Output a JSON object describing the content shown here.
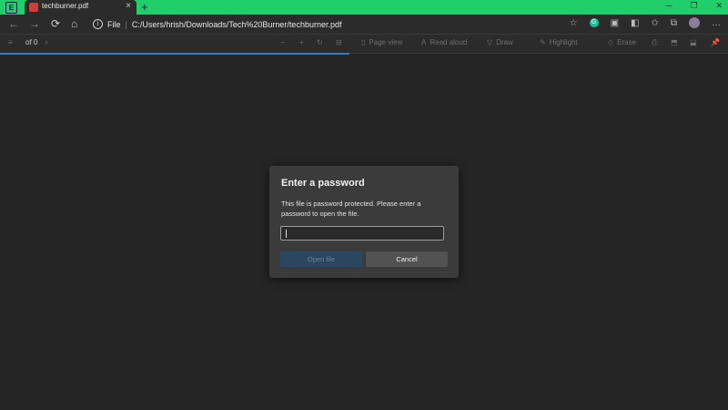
{
  "browser": {
    "tab_title": "techburner.pdf",
    "tab_close": "×",
    "new_tab": "+",
    "window_controls": [
      "─",
      "❐",
      "✕"
    ],
    "address_scheme": "File",
    "address_path": "C:/Users/hrish/Downloads/Tech%20Burner/techburner.pdf",
    "nav": {
      "back": "←",
      "forward": "→",
      "reload": "⟳",
      "home": "⌂"
    }
  },
  "pdf_toolbar": {
    "menu": "≡",
    "page_of": "of 0",
    "search": "⌕",
    "zoom_out": "−",
    "zoom_in": "+",
    "rotate": "↻",
    "fit": "⊟",
    "page_view": "Page view",
    "read_aloud": "Read aloud",
    "draw": "Draw",
    "highlight": "Highlight",
    "erase": "Erase",
    "print": "⎙",
    "save": "⬒",
    "save_as": "⬓",
    "pin": "📌"
  },
  "progress_value": 0.48,
  "dialog": {
    "title": "Enter a password",
    "message": "This file is password protected. Please enter a password to open the file.",
    "password_value": "",
    "open_label": "Open file",
    "cancel_label": "Cancel"
  },
  "colors": {
    "titlebar": "#1fcf6a",
    "accent": "#3c78b8",
    "background": "#252525"
  }
}
